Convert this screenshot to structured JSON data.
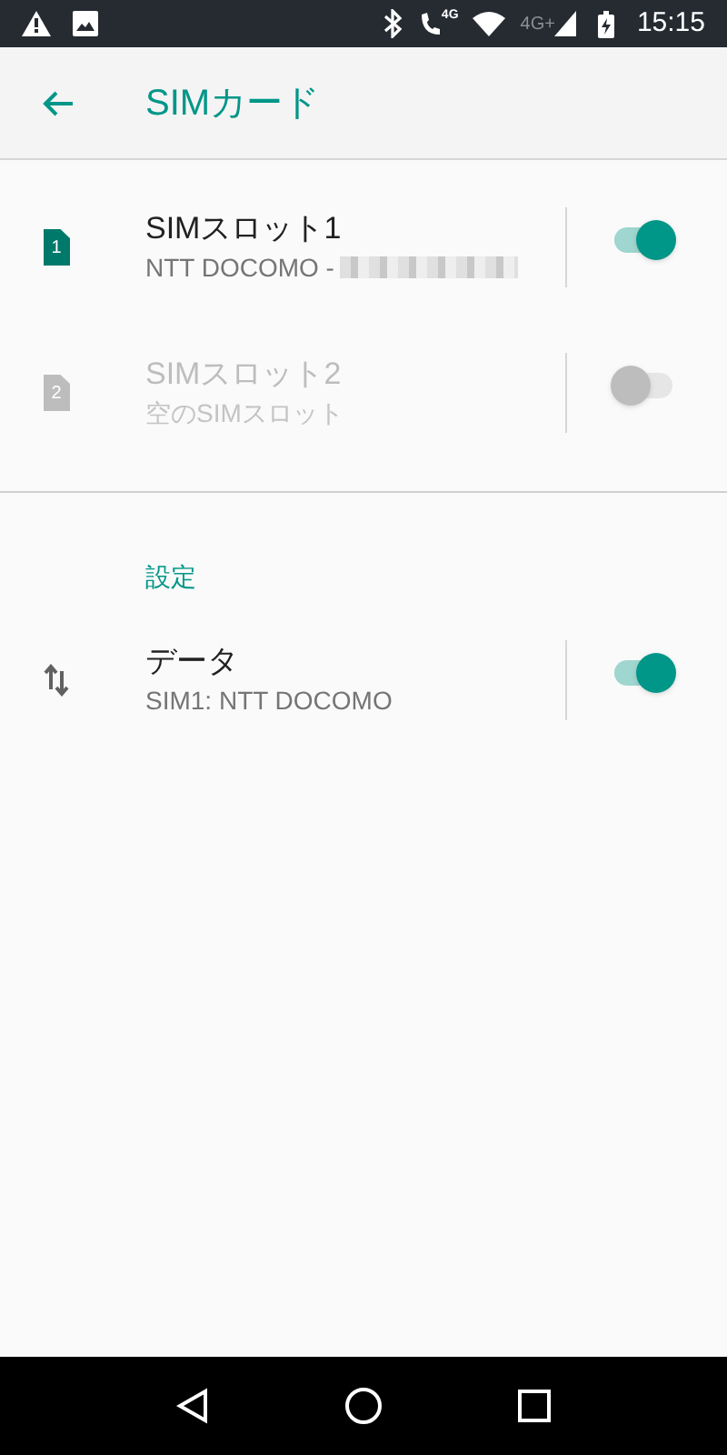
{
  "status_bar": {
    "call_network": "4G",
    "network": "4G+",
    "time": "15:15"
  },
  "toolbar": {
    "title": "SIMカード"
  },
  "sim_slots": [
    {
      "slot_number": "1",
      "title": "SIMスロット1",
      "subtitle": "NTT DOCOMO -",
      "redacted": true,
      "disabled": false,
      "on": true
    },
    {
      "slot_number": "2",
      "title": "SIMスロット2",
      "subtitle": "空のSIMスロット",
      "redacted": false,
      "disabled": true,
      "on": false
    }
  ],
  "settings": {
    "header": "設定",
    "items": [
      {
        "title": "データ",
        "subtitle": "SIM1: NTT DOCOMO",
        "disabled": false,
        "on": true
      }
    ]
  }
}
